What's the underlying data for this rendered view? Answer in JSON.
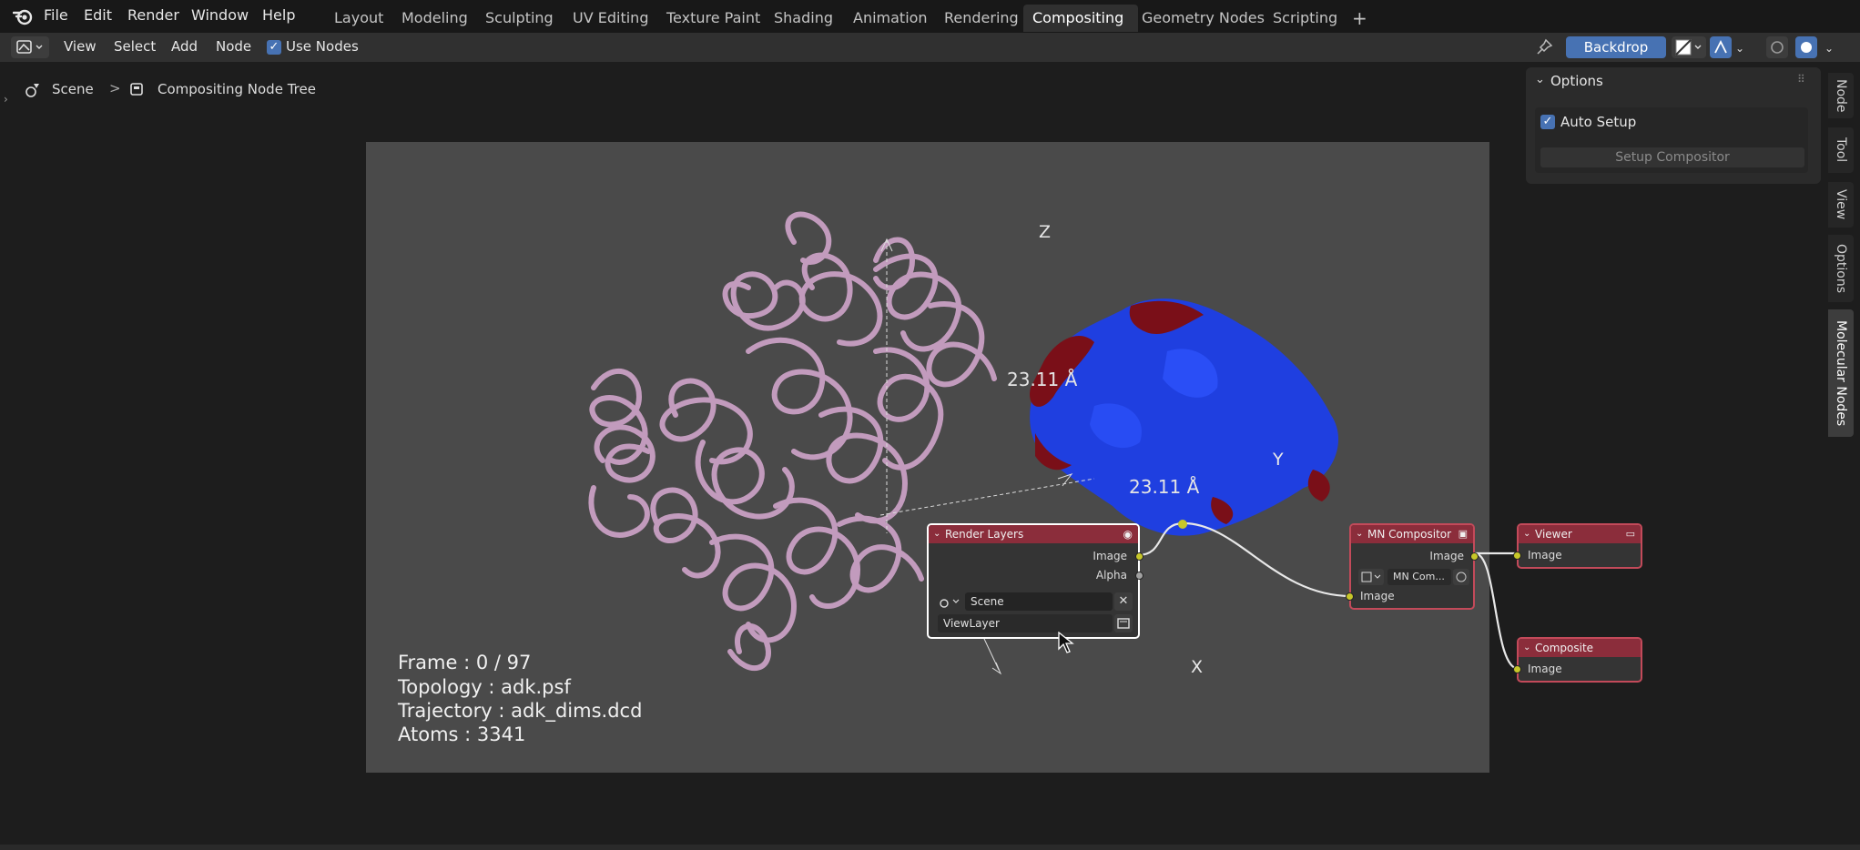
{
  "topbar": {
    "menus": [
      "File",
      "Edit",
      "Render",
      "Window",
      "Help"
    ],
    "workspaces": [
      "Layout",
      "Modeling",
      "Sculpting",
      "UV Editing",
      "Texture Paint",
      "Shading",
      "Animation",
      "Rendering",
      "Compositing",
      "Geometry Nodes",
      "Scripting"
    ],
    "active_workspace": "Compositing",
    "add_tab": "+"
  },
  "header": {
    "view": "View",
    "select": "Select",
    "add": "Add",
    "node": "Node",
    "use_nodes": "Use Nodes",
    "backdrop": "Backdrop"
  },
  "breadcrumb": {
    "scene": "Scene",
    "separator": ">",
    "tree": "Compositing Node Tree"
  },
  "overlay": {
    "frame": "Frame : 0 / 97",
    "topology": "Topology : adk.psf",
    "trajectory": "Trajectory : adk_dims.dcd",
    "atoms": "Atoms : 3341",
    "measure_1": "23.11 Å",
    "measure_2": "23.11 Å",
    "axis_z": "Z",
    "axis_y": "Y",
    "axis_x": "X"
  },
  "nodes": {
    "render_layers": {
      "title": "Render Layers",
      "out_image": "Image",
      "out_alpha": "Alpha",
      "scene": "Scene",
      "view_layer": "ViewLayer"
    },
    "mn_compositor": {
      "title": "MN Compositor",
      "out_image": "Image",
      "group": "MN Com...",
      "in_image": "Image"
    },
    "viewer": {
      "title": "Viewer",
      "in_image": "Image"
    },
    "composite": {
      "title": "Composite",
      "in_image": "Image"
    }
  },
  "options_panel": {
    "title": "Options",
    "auto_setup": "Auto Setup",
    "setup_button": "Setup Compositor"
  },
  "sidebar_tabs": [
    "Node",
    "Tool",
    "View",
    "Options",
    "Molecular Nodes"
  ],
  "active_sidebar_tab": "Molecular Nodes",
  "colors": {
    "accent": "#4772b3",
    "node_header": "#8b2d3b",
    "node_border": "#c34a5a",
    "socket_image": "#c7c729",
    "protein_ribbon": "#c9a0c4",
    "surface_blue": "#1f3fe0",
    "surface_red": "#7a0f18"
  }
}
